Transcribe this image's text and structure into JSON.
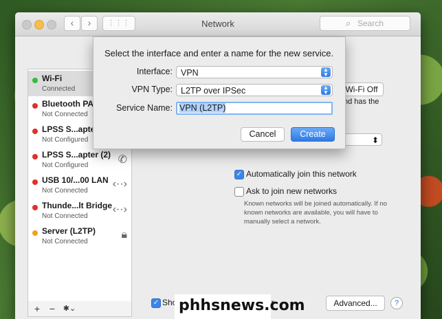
{
  "window": {
    "title": "Network",
    "search_placeholder": "Search",
    "back_glyph": "‹",
    "forward_glyph": "›",
    "grid_glyph": "⋮⋮⋮"
  },
  "sidebar": {
    "items": [
      {
        "name": "Wi-Fi",
        "status": "Connected",
        "color": "#2fbf3a",
        "icon": ""
      },
      {
        "name": "Bluetooth PAN",
        "status": "Not Connected",
        "color": "#e0302a",
        "icon": ""
      },
      {
        "name": "LPSS S...apter",
        "status": "Not Configured",
        "color": "#e0302a",
        "icon": "phone-icon"
      },
      {
        "name": "LPSS S...apter (2)",
        "status": "Not Configured",
        "color": "#e0302a",
        "icon": "phone-icon"
      },
      {
        "name": "USB 10/...00 LAN",
        "status": "Not Connected",
        "color": "#e0302a",
        "icon": "ethernet-icon"
      },
      {
        "name": "Thunde...lt Bridge",
        "status": "Not Connected",
        "color": "#e0302a",
        "icon": "ethernet-icon"
      },
      {
        "name": "Server (L2TP)",
        "status": "Not Connected",
        "color": "#f0a21d",
        "icon": "vpn-lock-icon"
      }
    ],
    "toolbar": {
      "add": "+",
      "remove": "−",
      "action": "✱⌄"
    }
  },
  "panel": {
    "wifi_off_button": "Wi-Fi Off",
    "status_fragment": "nd has the",
    "auto_join_label": "Automatically join this network",
    "auto_join_checked": true,
    "ask_join_label": "Ask to join new networks",
    "ask_join_checked": false,
    "note": "Known networks will be joined automatically. If no known networks are available, you will have to manually select a network.",
    "show_status_label": "Sho",
    "show_status_tail": "ar",
    "show_status_checked": true,
    "advanced_button": "Advanced...",
    "help_button": "?"
  },
  "sheet": {
    "heading": "Select the interface and enter a name for the new service.",
    "interface_label": "Interface:",
    "interface_value": "VPN",
    "vpn_type_label": "VPN Type:",
    "vpn_type_value": "L2TP over IPSec",
    "service_name_label": "Service Name:",
    "service_name_value": "VPN (L2TP)",
    "cancel_button": "Cancel",
    "create_button": "Create"
  },
  "watermark": "phhsnews.com",
  "colors": {
    "accent": "#2f7ae5",
    "connected": "#2fbf3a",
    "not_connected": "#e0302a",
    "pending": "#f0a21d"
  }
}
